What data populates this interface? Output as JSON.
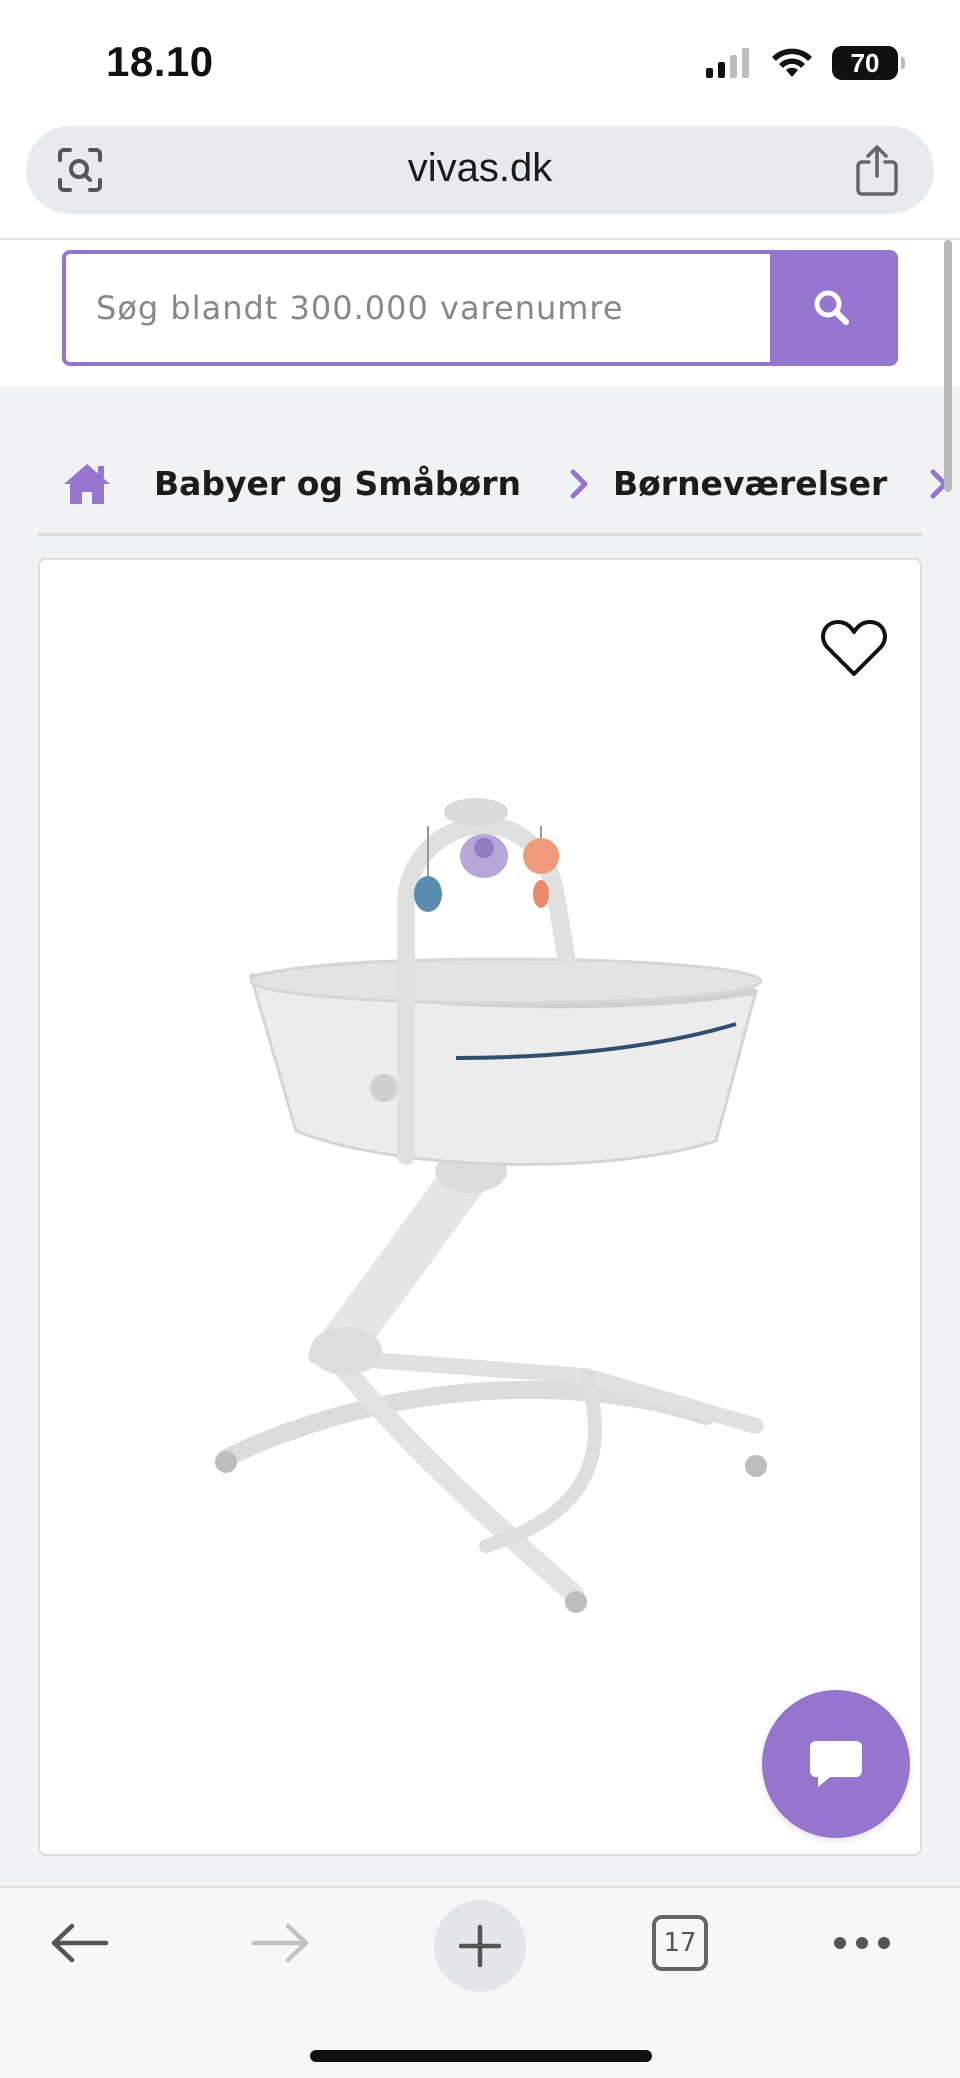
{
  "status_bar": {
    "time": "18.10",
    "battery": "70"
  },
  "browser": {
    "url": "vivas.dk",
    "tabs_count": "17"
  },
  "search": {
    "placeholder": "Søg blandt 300.000 varenumre"
  },
  "breadcrumb": {
    "items": [
      {
        "label": "Babyer og Småbørn"
      },
      {
        "label": "Børneværelser"
      }
    ]
  },
  "colors": {
    "accent": "#9575cd",
    "background": "#f1f2f3"
  },
  "icons": {
    "url_left": "screen-search-icon",
    "url_right": "share-icon",
    "search": "search-icon",
    "home": "home-icon",
    "favorite": "heart-icon",
    "chat": "chat-icon"
  }
}
